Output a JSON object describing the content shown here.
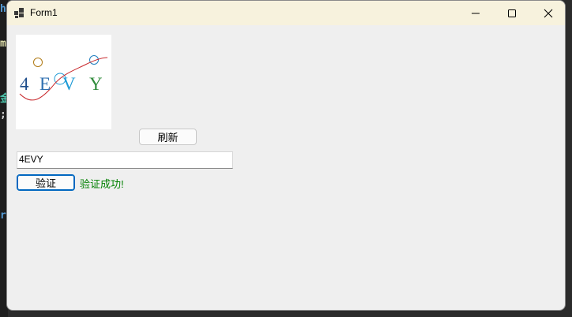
{
  "window": {
    "title": "Form1",
    "controls": {
      "minimize_icon": "minimize-icon",
      "maximize_icon": "maximize-icon",
      "close_icon": "close-icon"
    }
  },
  "captcha": {
    "characters": [
      "4",
      "E",
      "V",
      "Y"
    ],
    "colors": [
      "#1f4e8c",
      "#2e6fb0",
      "#1f9bd6",
      "#2e8b3a"
    ]
  },
  "buttons": {
    "refresh_label": "刷新",
    "verify_label": "验证"
  },
  "input": {
    "value": "4EVY"
  },
  "result": {
    "text": "验证成功!",
    "color": "#008000"
  }
}
